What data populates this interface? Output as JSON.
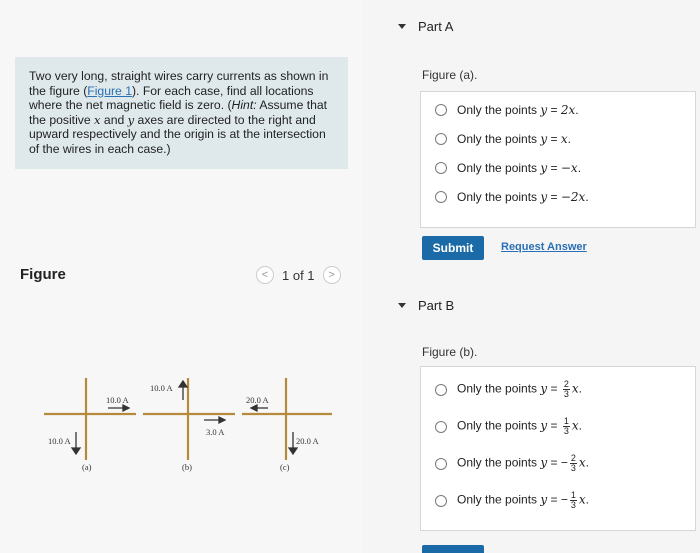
{
  "problem": {
    "intro": "Two very long, straight wires carry currents as shown in the figure (",
    "figure_link": "Figure 1",
    "after_link": "). For each case, find all locations where the net magnetic field is zero. (",
    "hint_label": "Hint:",
    "hint_a": " Assume that the positive ",
    "x": "x",
    "and": " and ",
    "y": "y",
    "hint_b": " axes are directed to the right and upward respectively and the origin is at the intersection of the wires in each case.)"
  },
  "figure_panel": {
    "heading": "Figure",
    "pager": "1 of 1",
    "prev": "<",
    "next": ">",
    "labels": {
      "a_current1": "10.0 A",
      "a_current2": "10.0 A",
      "a_caption": "(a)",
      "b_current1": "10.0 A",
      "b_current2": "3.0 A",
      "b_caption": "(b)",
      "c_current1": "20.0 A",
      "c_current2": "20.0 A",
      "c_caption": "(c)"
    }
  },
  "partA": {
    "title": "Part A",
    "figure_label": "Figure (a).",
    "options": [
      {
        "prefix": "Only the points ",
        "lhs": "y",
        "eq": " = ",
        "rhs": "2x",
        "tail": "."
      },
      {
        "prefix": "Only the points ",
        "lhs": "y",
        "eq": " = ",
        "rhs": "x",
        "tail": "."
      },
      {
        "prefix": "Only the points ",
        "lhs": "y",
        "eq": " = ",
        "rhs": "−x",
        "tail": "."
      },
      {
        "prefix": "Only the points ",
        "lhs": "y",
        "eq": " = ",
        "rhs": "−2x",
        "tail": "."
      }
    ],
    "submit": "Submit",
    "request": "Request Answer"
  },
  "partB": {
    "title": "Part B",
    "figure_label": "Figure (b).",
    "options": [
      {
        "prefix": "Only the points ",
        "lhs": "y",
        "eq": " = ",
        "sign": "",
        "num": "2",
        "den": "3",
        "var": "x",
        "tail": "."
      },
      {
        "prefix": "Only the points ",
        "lhs": "y",
        "eq": " = ",
        "sign": "",
        "num": "1",
        "den": "3",
        "var": "x",
        "tail": "."
      },
      {
        "prefix": "Only the points ",
        "lhs": "y",
        "eq": " = ",
        "sign": "−",
        "num": "2",
        "den": "3",
        "var": "x",
        "tail": "."
      },
      {
        "prefix": "Only the points ",
        "lhs": "y",
        "eq": " = ",
        "sign": "−",
        "num": "1",
        "den": "3",
        "var": "x",
        "tail": "."
      }
    ]
  },
  "colors": {
    "accent": "#1a6aa8",
    "link": "#2a70b5",
    "problem_bg": "#dfe9ec"
  }
}
